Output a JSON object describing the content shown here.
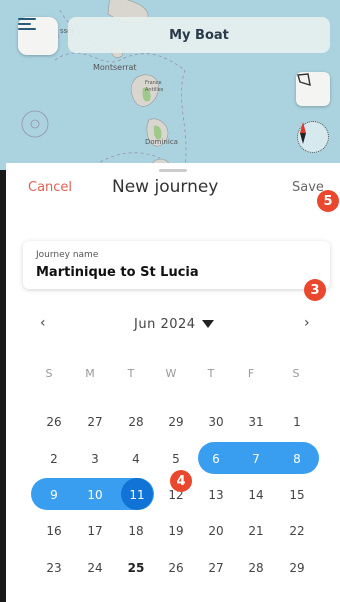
{
  "map": {
    "title": "My Boat",
    "labels": {
      "montserrat": "Montserrat",
      "france": "France",
      "france_sub": "Antilles",
      "dominica": "Dominica",
      "top_left": "sset"
    }
  },
  "sheet": {
    "cancel_label": "Cancel",
    "title": "New journey",
    "save_label": "Save"
  },
  "journey": {
    "label": "Journey name",
    "value": "Martinique to St Lucia"
  },
  "calendar": {
    "month_label": "Jun 2024",
    "prev_icon": "‹",
    "next_icon": "›",
    "weekdays": [
      "S",
      "M",
      "T",
      "W",
      "T",
      "F",
      "S"
    ],
    "weeks": [
      [
        "26",
        "27",
        "28",
        "29",
        "30",
        "31",
        "1"
      ],
      [
        "2",
        "3",
        "4",
        "5",
        "6",
        "7",
        "8"
      ],
      [
        "9",
        "10",
        "11",
        "12",
        "13",
        "14",
        "15"
      ],
      [
        "16",
        "17",
        "18",
        "19",
        "20",
        "21",
        "22"
      ],
      [
        "23",
        "24",
        "25",
        "26",
        "27",
        "28",
        "29"
      ]
    ],
    "selected_range": [
      "6",
      "11"
    ],
    "today": "25"
  },
  "badges": [
    "5",
    "3",
    "4"
  ],
  "colors": {
    "accent": "#3a9ef0",
    "accent_dark": "#1273d6",
    "cancel": "#e0605a",
    "badge": "#e9482f"
  },
  "icons": {
    "menu": "hamburger-icon",
    "polygon": "polygon-icon",
    "compass": "compass-icon",
    "dropdown": "caret-down-icon"
  }
}
